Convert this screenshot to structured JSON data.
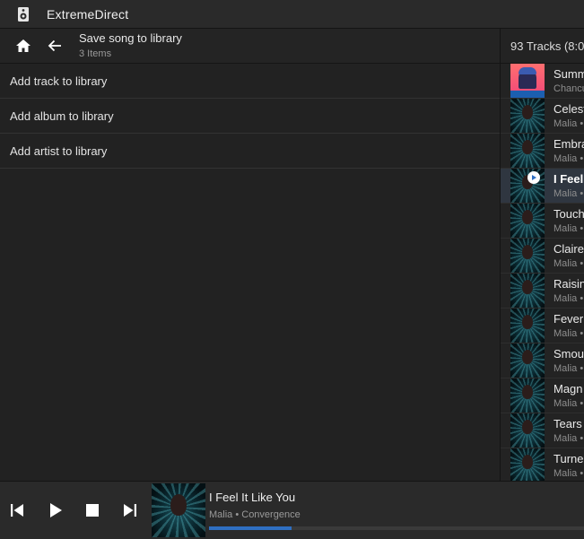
{
  "app": {
    "title": "ExtremeDirect",
    "icon": "speaker-icon"
  },
  "nav": {
    "title": "Save song to library",
    "subtitle": "3 Items",
    "home_icon": "home-icon",
    "back_icon": "arrow-left-icon"
  },
  "menu": {
    "items": [
      {
        "label": "Add track to library"
      },
      {
        "label": "Add album to library"
      },
      {
        "label": "Add artist to library"
      }
    ]
  },
  "tracks": {
    "header": "93 Tracks (8:0",
    "items": [
      {
        "name": "Summ",
        "sub": "Chancu",
        "art": "alt"
      },
      {
        "name": "Celest",
        "sub": "Malia •",
        "art": "malia"
      },
      {
        "name": "Embra",
        "sub": "Malia •",
        "art": "malia"
      },
      {
        "name": "I Feel",
        "sub": "Malia •",
        "art": "malia",
        "active": true
      },
      {
        "name": "Touch",
        "sub": "Malia •",
        "art": "malia"
      },
      {
        "name": "Claire",
        "sub": "Malia •",
        "art": "malia"
      },
      {
        "name": "Raisin",
        "sub": "Malia •",
        "art": "malia"
      },
      {
        "name": "Fever",
        "sub": "Malia •",
        "art": "malia"
      },
      {
        "name": "Smou",
        "sub": "Malia •",
        "art": "malia"
      },
      {
        "name": "Magn",
        "sub": "Malia •",
        "art": "malia"
      },
      {
        "name": "Tears",
        "sub": "Malia •",
        "art": "malia"
      },
      {
        "name": "Turne",
        "sub": "Malia •",
        "art": "malia"
      }
    ]
  },
  "player": {
    "title": "I Feel It Like You",
    "subtitle": "Malia • Convergence",
    "progress": 0.22,
    "accent": "#2f6fc2"
  }
}
